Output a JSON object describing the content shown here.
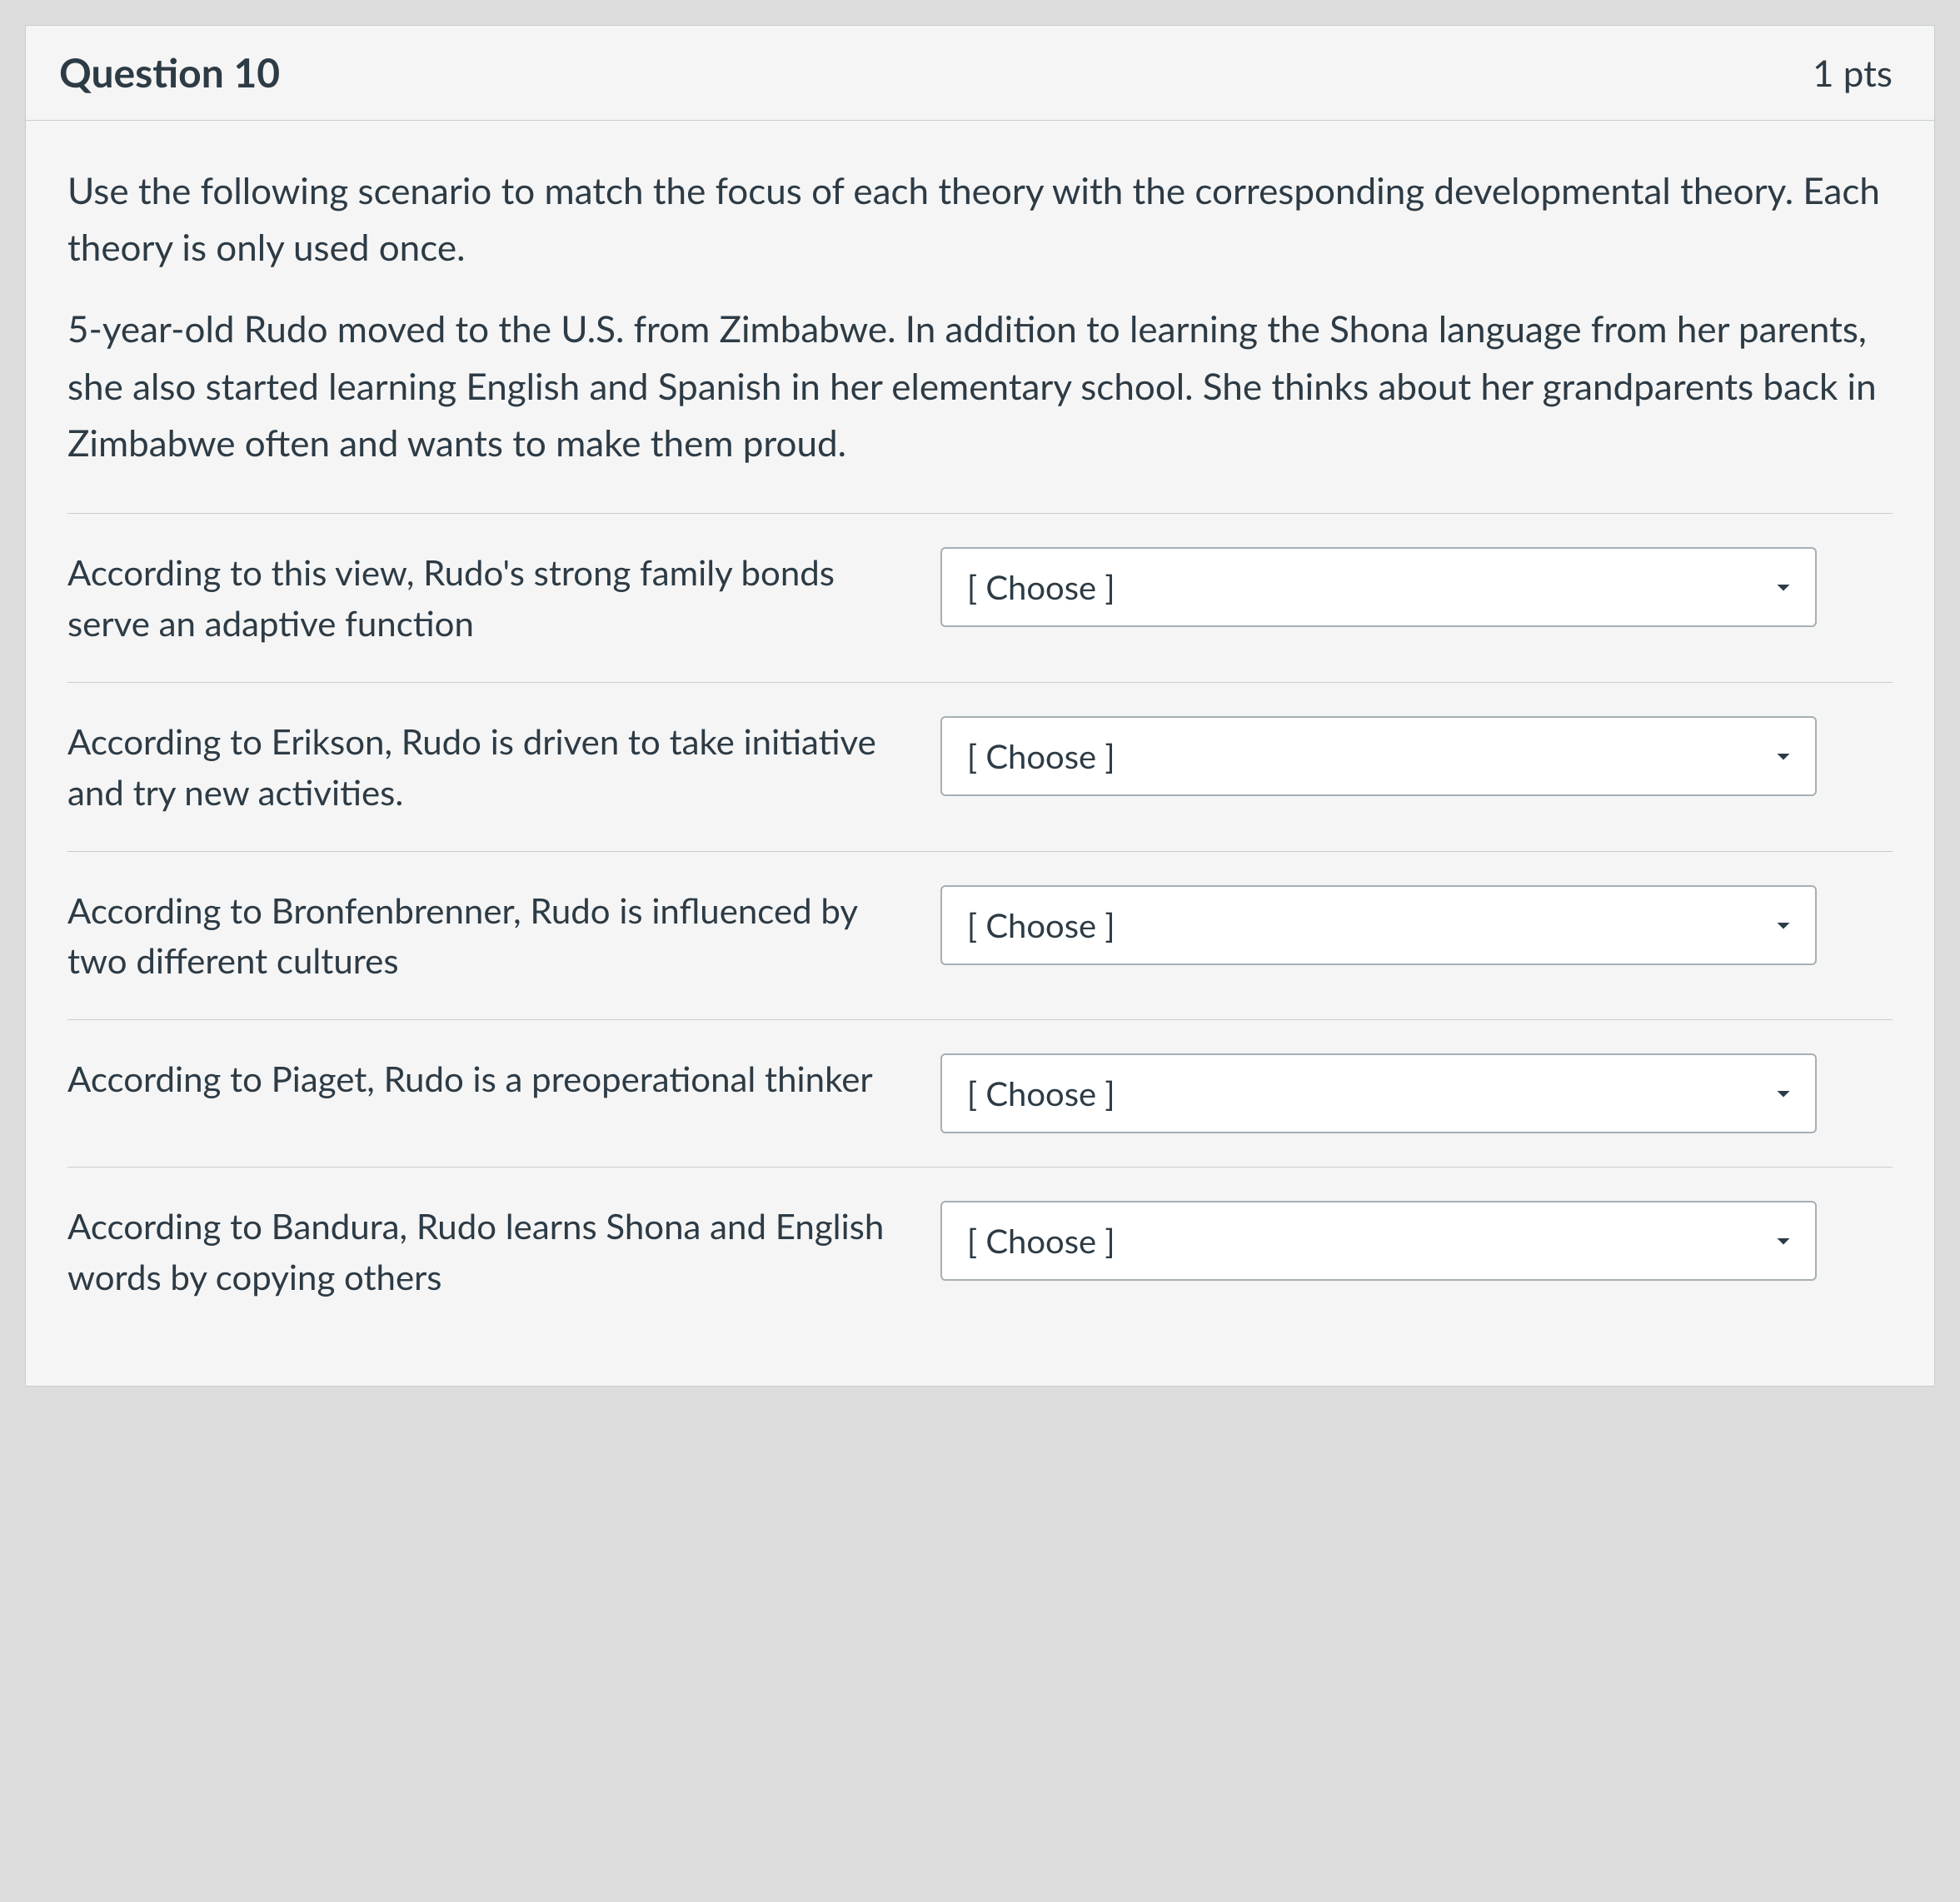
{
  "header": {
    "title": "Question 10",
    "points": "1 pts"
  },
  "instructions": "Use the following scenario to match the focus of each theory with the corresponding developmental theory. Each theory is only used once.",
  "scenario": "5-year-old Rudo moved to the U.S. from Zimbabwe. In addition to learning the Shona language from her parents, she also started learning English and Spanish in her elementary school. She thinks about her grandparents back in Zimbabwe often and wants to make them proud.",
  "dropdown_placeholder": "[ Choose ]",
  "matches": [
    {
      "prompt": "According to this view, Rudo's strong family bonds serve an adaptive function"
    },
    {
      "prompt": "According to Erikson, Rudo is driven to take initiative and try new activities."
    },
    {
      "prompt": "According to Bronfenbrenner, Rudo is influenced by two different cultures"
    },
    {
      "prompt": "According to Piaget, Rudo is a preoperational thinker"
    },
    {
      "prompt": "According to Bandura, Rudo learns Shona and English words by copying others"
    }
  ]
}
